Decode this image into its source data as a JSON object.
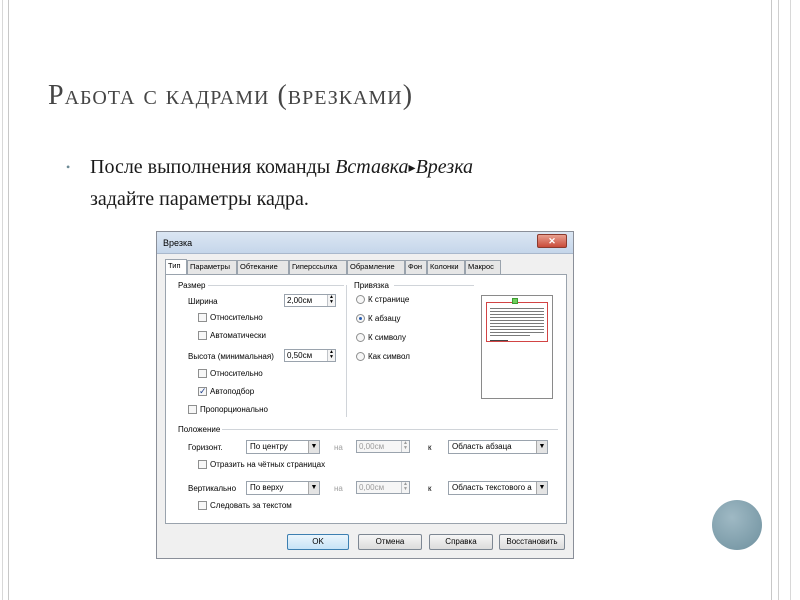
{
  "slide": {
    "title": "Работа с кадрами (врезками)",
    "bullet_symbol": "•",
    "bullet_line1_plain": "После выполнения команды ",
    "bullet_menu_1": "Вставка",
    "bullet_arrow": "▸",
    "bullet_menu_2": "Врезка",
    "bullet_line2": "задайте параметры кадра."
  },
  "dialog": {
    "title": "Врезка",
    "close_label": "✕",
    "tabs": [
      "Тип",
      "Параметры",
      "Обтекание",
      "Гиперссылка",
      "Обрамление",
      "Фон",
      "Колонки",
      "Макрос"
    ],
    "size_group": "Размер",
    "width_label": "Ширина",
    "width_value": "2,00см",
    "relative_label_1": "Относительно",
    "auto_label": "Автоматически",
    "height_label": "Высота (минимальная)",
    "height_value": "0,50см",
    "relative_label_2": "Относительно",
    "autofit_label": "Автоподбор",
    "proportional_label": "Пропорционально",
    "anchor_group": "Привязка",
    "anchor_page": "К странице",
    "anchor_paragraph": "К абзацу",
    "anchor_char": "К символу",
    "anchor_as_char": "Как символ",
    "position_group": "Положение",
    "horiz_label": "Горизонт.",
    "horiz_select": "По центру",
    "on_label_1": "на",
    "horiz_offset": "0,00см",
    "to_label_1": "к",
    "horiz_target": "Область абзаца",
    "mirror_label": "Отразить на чётных страницах",
    "vert_label": "Вертикально",
    "vert_select": "По верху",
    "on_label_2": "на",
    "vert_offset": "0,00см",
    "to_label_2": "к",
    "vert_target": "Область текстового а",
    "follow_label": "Следовать за текстом",
    "ok": "OK",
    "cancel": "Отмена",
    "help": "Справка",
    "reset": "Восстановить"
  }
}
